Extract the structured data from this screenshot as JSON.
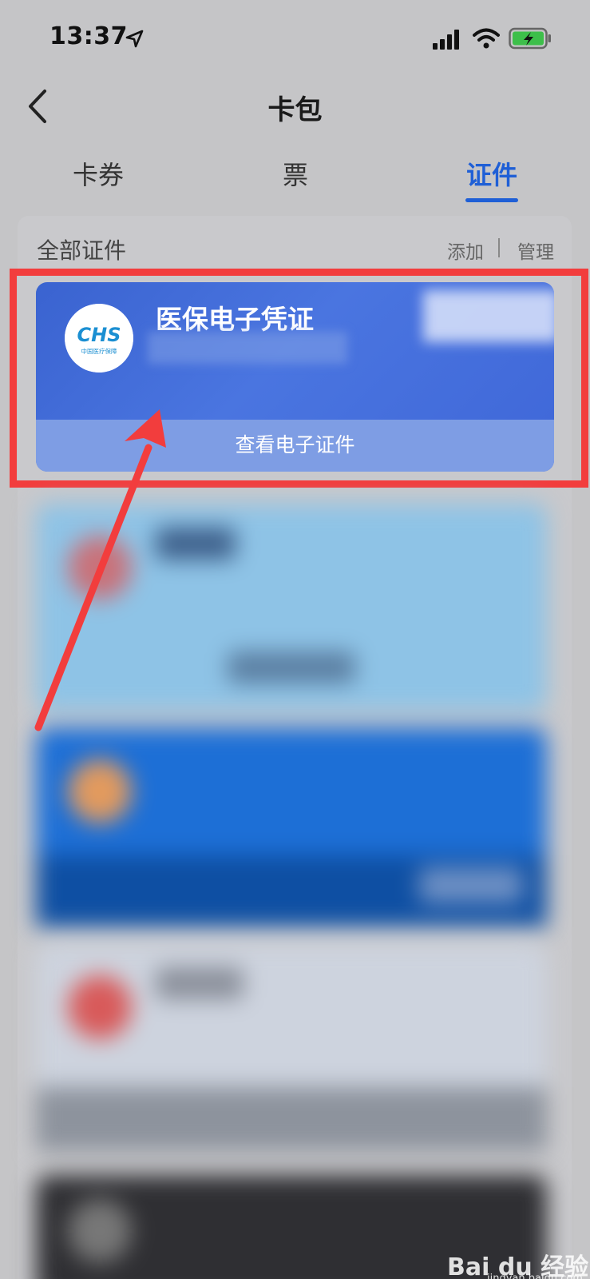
{
  "status_bar": {
    "time": "13:37"
  },
  "nav": {
    "title": "卡包"
  },
  "tabs": [
    {
      "label": "卡券"
    },
    {
      "label": "票"
    },
    {
      "label": "证件",
      "active": true
    }
  ],
  "section": {
    "title": "全部证件",
    "add_label": "添加",
    "separator": "|",
    "manage_label": "管理"
  },
  "main_card": {
    "logo_text": "CHS",
    "logo_subtext": "中国医疗保障",
    "title": "医保电子凭证",
    "action_label": "查看电子证件"
  },
  "watermark": {
    "brand": "Bai du 经验",
    "url": "jingyan.baidu.com"
  },
  "colors": {
    "accent": "#1f5fd6",
    "highlight": "#f23d3d",
    "card_blue": "#3f67d8"
  }
}
